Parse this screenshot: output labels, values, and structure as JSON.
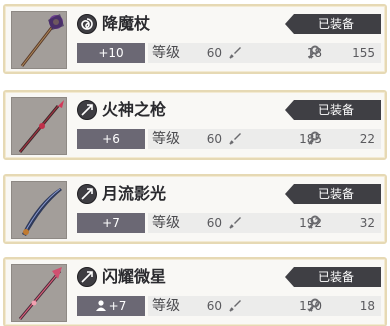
{
  "equip_label": "已装备",
  "level_label": "等级",
  "items": [
    {
      "name": "降魔杖",
      "enhance": "+10",
      "level": "60",
      "attack": "18",
      "defense": "155",
      "has_person": false,
      "type_icon": "spiral-icon"
    },
    {
      "name": "火神之枪",
      "enhance": "+6",
      "level": "60",
      "attack": "185",
      "defense": "22",
      "has_person": false,
      "type_icon": "arrow-icon"
    },
    {
      "name": "月流影光",
      "enhance": "+7",
      "level": "60",
      "attack": "192",
      "defense": "32",
      "has_person": false,
      "type_icon": "arrow-icon"
    },
    {
      "name": "闪耀微星",
      "enhance": "+7",
      "level": "60",
      "attack": "150",
      "defense": "18",
      "has_person": true,
      "type_icon": "arrow-icon"
    }
  ],
  "colors": {
    "badge_bg": "#3f3f44",
    "enhance_bg": "#6b6874",
    "border": "#e6d9b4"
  }
}
